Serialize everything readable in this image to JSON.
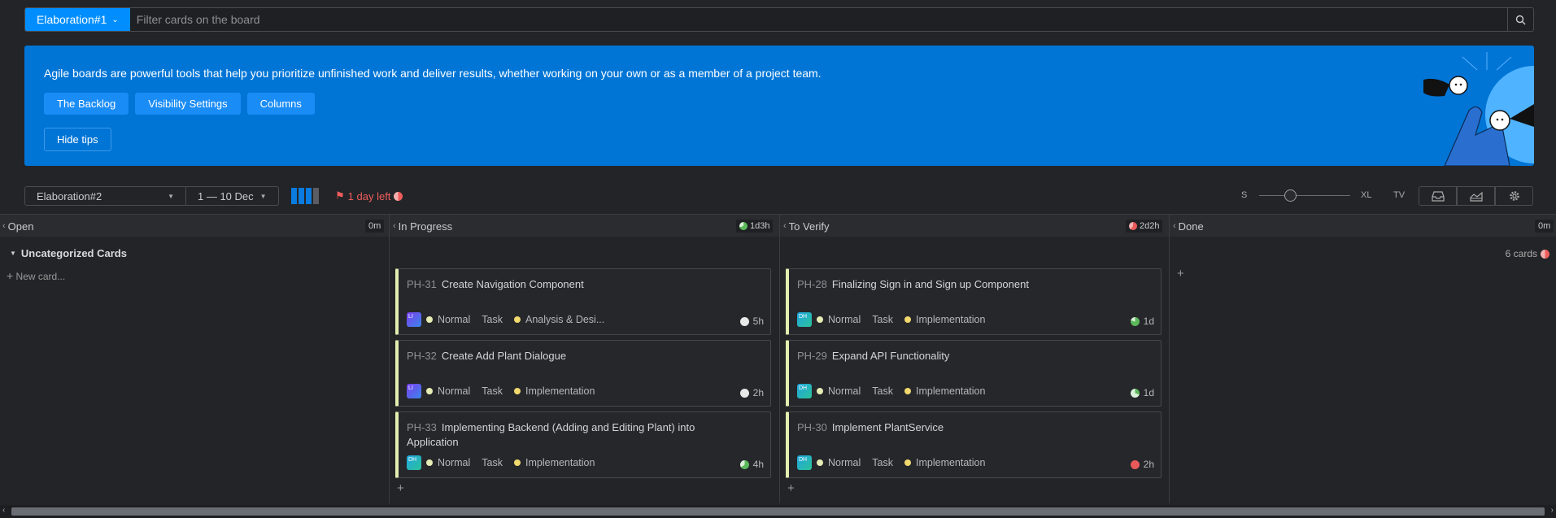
{
  "search": {
    "board_name": "Elaboration#1",
    "placeholder": "Filter cards on the board"
  },
  "banner": {
    "text": "Agile boards are powerful tools that help you prioritize unfinished work and deliver results, whether working on your own or as a member of a project team.",
    "buttons": [
      "The Backlog",
      "Visibility Settings",
      "Columns"
    ],
    "hide_tips": "Hide tips"
  },
  "toolbar": {
    "sprint": "Elaboration#2",
    "dates": "1 — 10 Dec",
    "days_left": "1 day left",
    "size_s": "S",
    "size_xl": "XL",
    "size_tv": "TV"
  },
  "columns": [
    {
      "name": "Open",
      "time": "0m"
    },
    {
      "name": "In Progress",
      "time": "1d3h"
    },
    {
      "name": "To Verify",
      "time": "2d2h"
    },
    {
      "name": "Done",
      "time": "0m"
    }
  ],
  "swimlane": {
    "title": "Uncategorized Cards",
    "count": "6 cards",
    "new_card": "New card..."
  },
  "cards": [
    {
      "id": "PH-31",
      "title": "Create Navigation Component",
      "avatar": "LI",
      "priority": "Normal",
      "type": "Task",
      "state": "Analysis & Desi...",
      "estimate": "5h",
      "est_color": "#e8e8e8"
    },
    {
      "id": "PH-32",
      "title": "Create Add Plant Dialogue",
      "avatar": "LI",
      "priority": "Normal",
      "type": "Task",
      "state": "Implementation",
      "estimate": "2h",
      "est_color": "#e8e8e8"
    },
    {
      "id": "PH-33",
      "title": "Implementing Backend (Adding and Editing Plant) into Application",
      "avatar": "DH",
      "priority": "Normal",
      "type": "Task",
      "state": "Implementation",
      "estimate": "4h",
      "est_color": "#5bb85b"
    },
    {
      "id": "PH-28",
      "title": "Finalizing Sign in and Sign up Component",
      "avatar": "DH",
      "priority": "Normal",
      "type": "Task",
      "state": "Implementation",
      "estimate": "1d",
      "est_color": "#5bb85b"
    },
    {
      "id": "PH-29",
      "title": "Expand API Functionality",
      "avatar": "DH",
      "priority": "Normal",
      "type": "Task",
      "state": "Implementation",
      "estimate": "1d",
      "est_color": "#9ad19a"
    },
    {
      "id": "PH-30",
      "title": "Implement PlantService",
      "avatar": "DH",
      "priority": "Normal",
      "type": "Task",
      "state": "Implementation",
      "estimate": "2h",
      "est_color": "#e85a5a"
    }
  ],
  "colors": {
    "accent": "#008eff",
    "banner": "#0075d6",
    "card_stripe": "#e3edb0",
    "overdue": "#ef5d5d"
  }
}
